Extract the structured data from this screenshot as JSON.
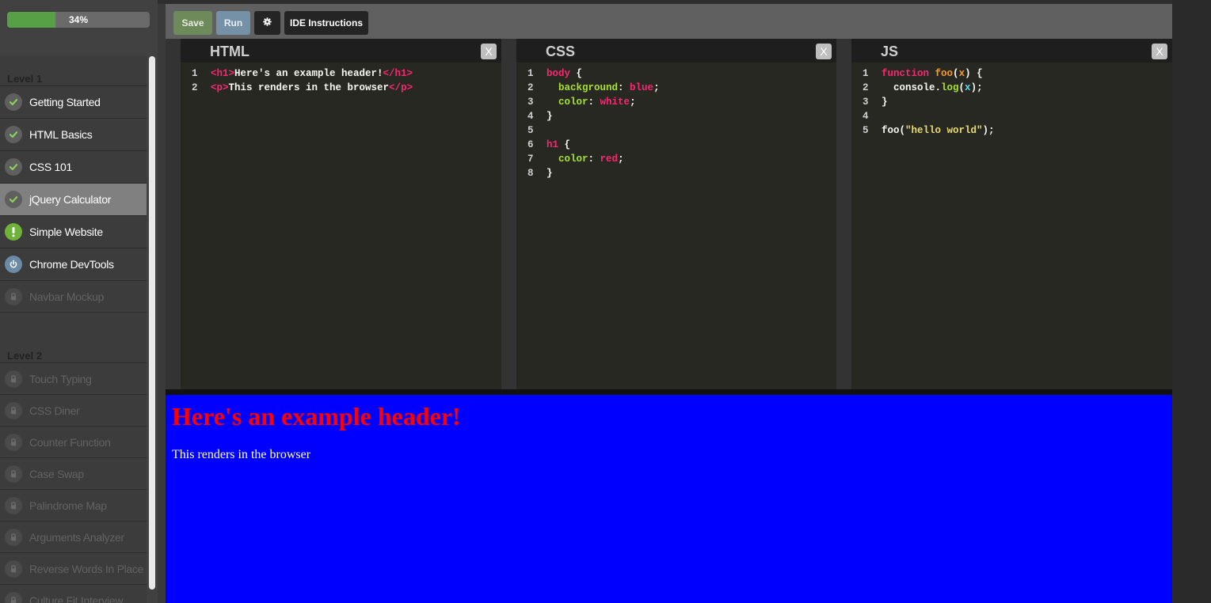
{
  "progress": {
    "label": "34%",
    "fraction": 0.34
  },
  "sidebar": {
    "levels": [
      {
        "title": "Level 1",
        "lessons": [
          {
            "label": "Getting Started",
            "status": "complete",
            "icon": "check-icon"
          },
          {
            "label": "HTML Basics",
            "status": "complete",
            "icon": "check-icon"
          },
          {
            "label": "CSS 101",
            "status": "complete",
            "icon": "check-icon"
          },
          {
            "label": "jQuery Calculator",
            "status": "complete",
            "icon": "check-icon",
            "active": true
          },
          {
            "label": "Simple Website",
            "status": "attention",
            "icon": "exclamation-icon"
          },
          {
            "label": "Chrome DevTools",
            "status": "available",
            "icon": "power-icon"
          },
          {
            "label": "Navbar Mockup",
            "status": "locked",
            "icon": "lock-icon"
          }
        ]
      },
      {
        "title": "Level 2",
        "lessons": [
          {
            "label": "Touch Typing",
            "status": "locked",
            "icon": "lock-icon"
          },
          {
            "label": "CSS Diner",
            "status": "locked",
            "icon": "lock-icon"
          },
          {
            "label": "Counter Function",
            "status": "locked",
            "icon": "lock-icon"
          },
          {
            "label": "Case Swap",
            "status": "locked",
            "icon": "lock-icon"
          },
          {
            "label": "Palindrome Map",
            "status": "locked",
            "icon": "lock-icon"
          },
          {
            "label": "Arguments Analyzer",
            "status": "locked",
            "icon": "lock-icon"
          },
          {
            "label": "Reverse Words In Place",
            "status": "locked",
            "icon": "lock-icon"
          },
          {
            "label": "Culture Fit Interview",
            "status": "locked",
            "icon": "lock-icon"
          }
        ]
      }
    ]
  },
  "toolbar": {
    "save_label": "Save",
    "run_label": "Run",
    "settings_icon": "gear-icon",
    "ide_instructions_label": "IDE Instructions"
  },
  "editors": {
    "html": {
      "title": "HTML",
      "close_label": "X",
      "lines": [
        [
          [
            "tag",
            "<h1>"
          ],
          [
            "text",
            "Here's an example header!"
          ],
          [
            "tag",
            "</h1>"
          ]
        ],
        [
          [
            "tag",
            "<p>"
          ],
          [
            "text",
            "This renders in the browser"
          ],
          [
            "tag",
            "</p>"
          ]
        ]
      ]
    },
    "css": {
      "title": "CSS",
      "close_label": "X",
      "lines": [
        [
          [
            "sel",
            "body"
          ],
          [
            "punc",
            " {"
          ]
        ],
        [
          [
            "text",
            "  "
          ],
          [
            "prop",
            "background"
          ],
          [
            "punc",
            ": "
          ],
          [
            "val",
            "blue"
          ],
          [
            "punc",
            ";"
          ]
        ],
        [
          [
            "text",
            "  "
          ],
          [
            "prop",
            "color"
          ],
          [
            "punc",
            ": "
          ],
          [
            "val",
            "white"
          ],
          [
            "punc",
            ";"
          ]
        ],
        [
          [
            "punc",
            "}"
          ]
        ],
        [],
        [
          [
            "sel",
            "h1"
          ],
          [
            "punc",
            " {"
          ]
        ],
        [
          [
            "text",
            "  "
          ],
          [
            "prop",
            "color"
          ],
          [
            "punc",
            ": "
          ],
          [
            "val",
            "red"
          ],
          [
            "punc",
            ";"
          ]
        ],
        [
          [
            "punc",
            "}"
          ]
        ]
      ]
    },
    "js": {
      "title": "JS",
      "close_label": "X",
      "lines": [
        [
          [
            "kw",
            "function"
          ],
          [
            "text",
            " "
          ],
          [
            "fn",
            "foo"
          ],
          [
            "punc",
            "("
          ],
          [
            "param",
            "x"
          ],
          [
            "punc",
            ") {"
          ]
        ],
        [
          [
            "text",
            "  console."
          ],
          [
            "call",
            "log"
          ],
          [
            "punc",
            "("
          ],
          [
            "var",
            "x"
          ],
          [
            "punc",
            ");"
          ]
        ],
        [
          [
            "punc",
            "}"
          ]
        ],
        [],
        [
          [
            "text",
            "foo("
          ],
          [
            "str",
            "\"hello world\""
          ],
          [
            "punc",
            ");"
          ]
        ]
      ]
    }
  },
  "preview": {
    "heading": "Here's an example header!",
    "paragraph": "This renders in the browser",
    "background": "#0000ff",
    "heading_color": "#ff0000",
    "text_color": "#ffffff"
  },
  "colors": {
    "progress_green": "#58a046",
    "save_green": "#6d8a5a",
    "run_blue": "#7591a8",
    "editor_bg": "#272822"
  }
}
